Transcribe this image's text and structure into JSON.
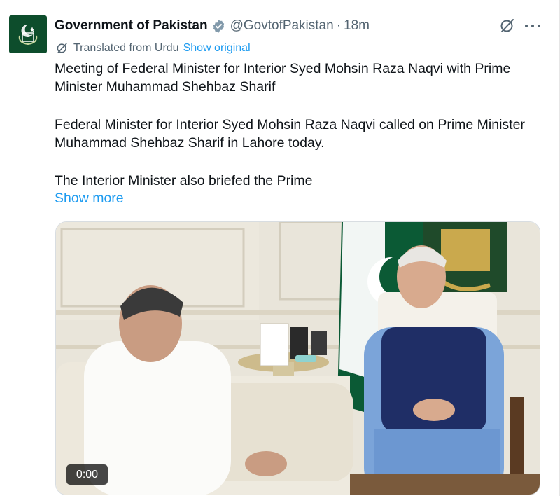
{
  "tweet": {
    "display_name": "Government of Pakistan",
    "handle": "@GovtofPakistan",
    "separator": "·",
    "time": "18m",
    "verified_icon": "verified-badge-icon",
    "translation": {
      "label": "Translated from Urdu",
      "show_original": "Show original"
    },
    "paragraphs": [
      "Meeting of Federal Minister for Interior Syed Mohsin Raza Naqvi with Prime Minister Muhammad Shehbaz Sharif",
      "Federal Minister for Interior Syed Mohsin Raza Naqvi called on Prime Minister Muhammad Shehbaz Sharif in Lahore today.",
      "The Interior Minister also briefed the Prime"
    ],
    "show_more": "Show more",
    "media": {
      "type": "video",
      "duration": "0:00"
    }
  },
  "colors": {
    "link": "#1d9bf0",
    "secondary_text": "#536471",
    "primary_text": "#0f1419",
    "avatar_bg": "#0d4d2c"
  }
}
